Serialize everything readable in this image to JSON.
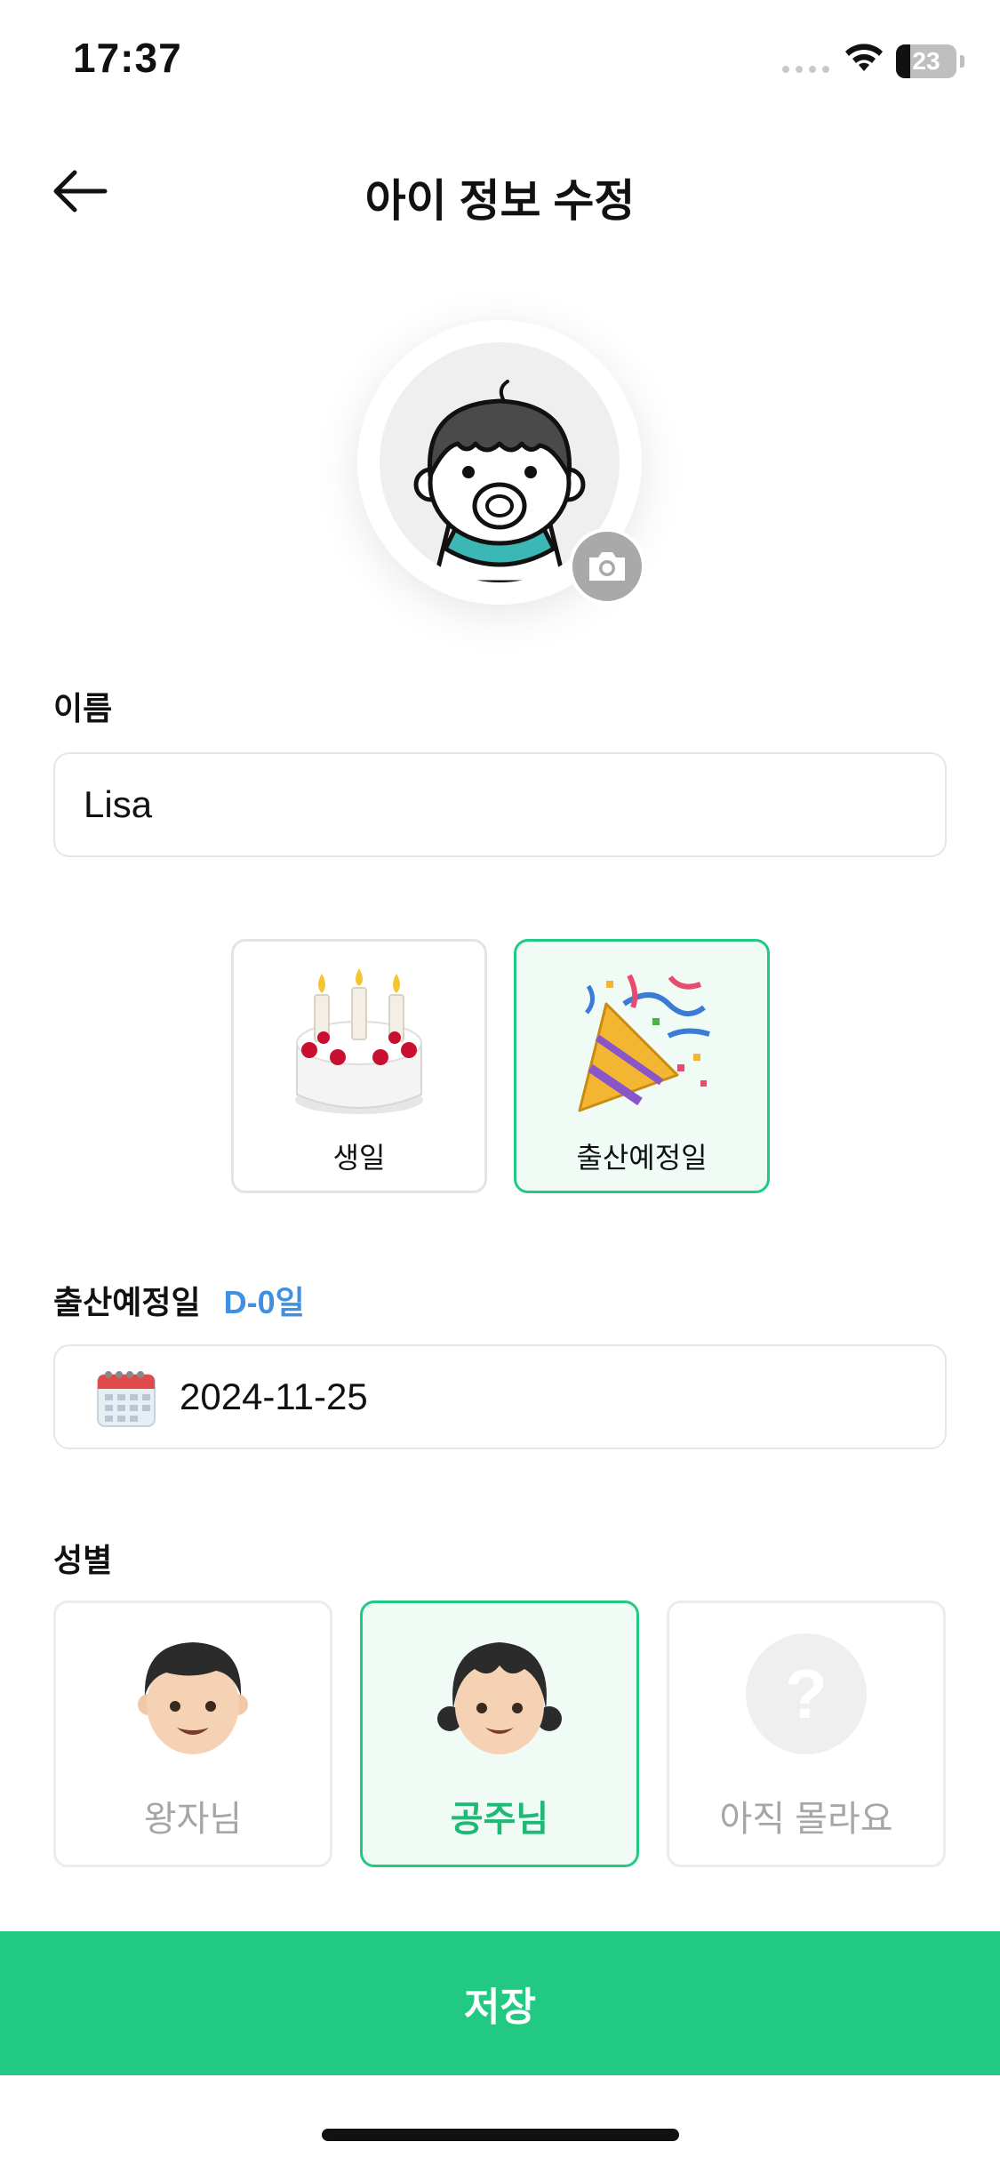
{
  "status_bar": {
    "time": "17:37",
    "battery": "23",
    "battery_level": 0.23
  },
  "header": {
    "title": "아이 정보 수정"
  },
  "name_section": {
    "label": "이름",
    "value": "Lisa"
  },
  "date_types": [
    {
      "label": "생일",
      "icon": "birthday-cake-icon",
      "selected": false
    },
    {
      "label": "출산예정일",
      "icon": "party-popper-icon",
      "selected": true
    }
  ],
  "due_date": {
    "label": "출산예정일",
    "d_day": "D-0일",
    "value": "2024-11-25"
  },
  "gender": {
    "label": "성별",
    "options": [
      {
        "label": "왕자님",
        "icon": "boy-icon",
        "selected": false
      },
      {
        "label": "공주님",
        "icon": "girl-icon",
        "selected": true
      },
      {
        "label": "아직 몰라요",
        "icon": "question-icon",
        "selected": false
      }
    ]
  },
  "save_label": "저장",
  "colors": {
    "accent": "#22c983",
    "accent_bg": "#f0fbf6",
    "d_day": "#3f8fe3"
  }
}
